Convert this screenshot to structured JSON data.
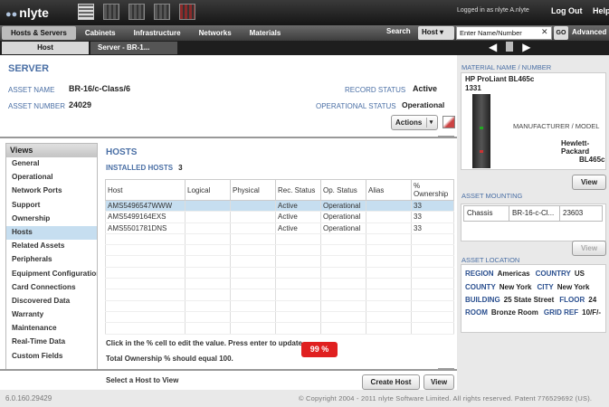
{
  "app": {
    "logo": "nlyte",
    "logged_in": "Logged in as nlyte  A.nlyte",
    "logout": "Log Out",
    "help": "Help"
  },
  "menu": [
    "Hosts & Servers",
    "Cabinets",
    "Infrastructure",
    "Networks",
    "Materials"
  ],
  "search": {
    "label": "Search",
    "scope": "Host",
    "placeholder": "Enter Name/Number",
    "go": "GO",
    "advanced": "Advanced"
  },
  "tabs": {
    "host": "Host",
    "server": "Server - BR-1..."
  },
  "server": {
    "heading": "SERVER",
    "asset_name_label": "ASSET NAME",
    "asset_name": "BR-16/c-Class/6",
    "asset_number_label": "ASSET NUMBER",
    "asset_number": "24029",
    "record_status_label": "RECORD STATUS",
    "record_status": "Active",
    "operational_status_label": "OPERATIONAL STATUS",
    "operational_status": "Operational",
    "actions": "Actions"
  },
  "views": {
    "title": "Views",
    "items": [
      "General",
      "Operational",
      "Network Ports",
      "Support",
      "Ownership",
      "Hosts",
      "Related Assets",
      "Peripherals",
      "Equipment Configuration",
      "Card Connections",
      "Discovered Data",
      "Warranty",
      "Maintenance",
      "Real-Time Data",
      "Custom Fields"
    ],
    "selected": "Hosts"
  },
  "hosts": {
    "heading": "HOSTS",
    "installed_label": "INSTALLED HOSTS",
    "installed_count": "3",
    "columns": [
      "Host",
      "Logical",
      "Physical",
      "Rec. Status",
      "Op. Status",
      "Alias",
      "% Ownership"
    ],
    "rows": [
      [
        "AMS5496547WWW",
        "",
        "",
        "Active",
        "Operational",
        "",
        "33"
      ],
      [
        "AMS5499164EXS",
        "",
        "",
        "Active",
        "Operational",
        "",
        "33"
      ],
      [
        "AMS5501781DNS",
        "",
        "",
        "Active",
        "Operational",
        "",
        "33"
      ]
    ],
    "note1": "Click in the % cell to edit the value. Press enter to update.",
    "note2": "Total Ownership % should equal 100.",
    "total_pct": "99 %",
    "select_prompt": "Select a Host to View",
    "create_button": "Create Host",
    "view_button": "View"
  },
  "material": {
    "header": "MATERIAL NAME / NUMBER",
    "name": "HP ProLiant BL465c",
    "number": "1331",
    "manufacturer_label": "MANUFACTURER / MODEL",
    "manufacturer": "Hewlett-Packard",
    "model": "BL465c",
    "view": "View"
  },
  "mounting": {
    "header": "ASSET MOUNTING",
    "cells": [
      "Chassis",
      "BR-16-c-Cl...",
      "23603"
    ],
    "view": "View"
  },
  "location": {
    "header": "ASSET LOCATION",
    "region_label": "REGION",
    "region": "Americas",
    "country_label": "COUNTRY",
    "country": "US",
    "county_label": "COUNTY",
    "county": "New York",
    "city_label": "CITY",
    "city": "New York",
    "building_label": "BUILDING",
    "building": "25 State Street",
    "floor_label": "FLOOR",
    "floor": "24",
    "room_label": "ROOM",
    "room": "Bronze Room",
    "gridref_label": "GRID REF",
    "gridref": "10/F/-"
  },
  "footer": {
    "version": "6.0.160.29429",
    "copyright": "© Copyright 2004 - 2011 nlyte Software Limited. All rights reserved. Patent 776529692 (US)."
  }
}
